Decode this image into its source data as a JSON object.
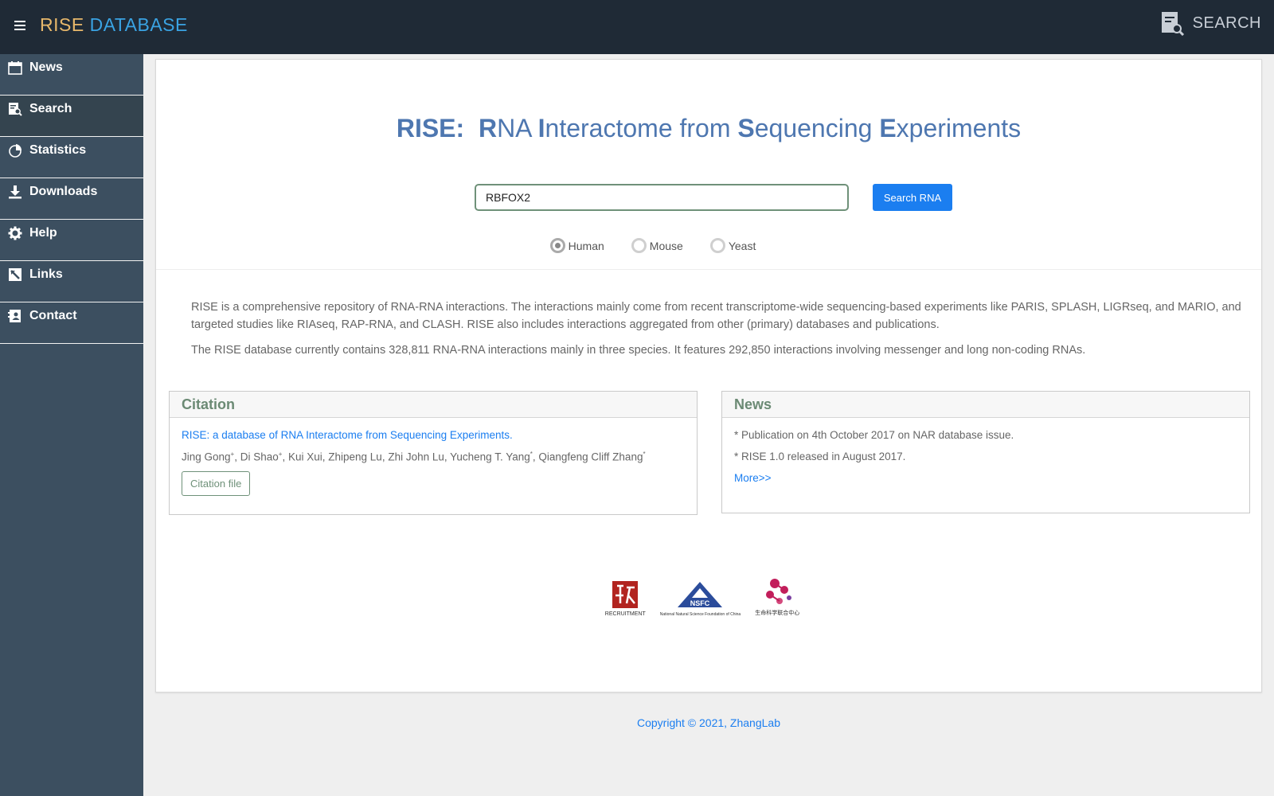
{
  "header": {
    "brand_part1": "RISE",
    "brand_part2": "DATABASE",
    "search_label": "SEARCH"
  },
  "sidebar": {
    "items": [
      {
        "label": "News",
        "icon": "calendar-icon"
      },
      {
        "label": "Search",
        "icon": "search-doc-icon"
      },
      {
        "label": "Statistics",
        "icon": "pie-chart-icon"
      },
      {
        "label": "Downloads",
        "icon": "download-icon"
      },
      {
        "label": "Help",
        "icon": "gear-icon"
      },
      {
        "label": "Links",
        "icon": "link-icon"
      },
      {
        "label": "Contact",
        "icon": "contact-icon"
      }
    ],
    "active_index": 1
  },
  "hero": {
    "title_prefix": "RISE:",
    "title_words": [
      {
        "initial": "R",
        "rest": "NA"
      },
      {
        "initial": "I",
        "rest": "nteractome from"
      },
      {
        "initial": "S",
        "rest": "equencing"
      },
      {
        "initial": "E",
        "rest": "xperiments"
      }
    ],
    "search_value": "RBFOX2",
    "search_button": "Search RNA",
    "species": [
      {
        "label": "Human",
        "selected": true
      },
      {
        "label": "Mouse",
        "selected": false
      },
      {
        "label": "Yeast",
        "selected": false
      }
    ]
  },
  "description": {
    "p1": "RISE is a comprehensive repository of RNA-RNA interactions. The interactions mainly come from recent transcriptome-wide sequencing-based experiments like PARIS, SPLASH, LIGRseq, and MARIO, and targeted studies like RIAseq, RAP-RNA, and CLASH. RISE also includes interactions aggregated from other (primary) databases and publications.",
    "p2": "The RISE database currently contains 328,811 RNA-RNA interactions mainly in three species. It features 292,850 interactions involving messenger and long non-coding RNAs."
  },
  "citation": {
    "heading": "Citation",
    "paper_title": "RISE: a database of RNA Interactome from Sequencing Experiments.",
    "authors": [
      {
        "name": "Jing Gong",
        "mark": "+"
      },
      {
        "name": "Di Shao",
        "mark": "+"
      },
      {
        "name": "Kui Xui",
        "mark": ""
      },
      {
        "name": "Zhipeng Lu",
        "mark": ""
      },
      {
        "name": "Zhi John Lu",
        "mark": ""
      },
      {
        "name": "Yucheng T. Yang",
        "mark": "*"
      },
      {
        "name": "Qiangfeng Cliff Zhang",
        "mark": "*"
      }
    ],
    "button": "Citation file"
  },
  "news": {
    "heading": "News",
    "items": [
      "* Publication on 4th October 2017 on NAR database issue.",
      "* RISE 1.0 released in August 2017."
    ],
    "more": "More>>"
  },
  "logos": {
    "recruitment_caption": "RECRUITMENT",
    "nsfc_text": "NSFC",
    "nsfc_caption": "National Natural Science Foundation of China",
    "cls_caption": "生命科学联合中心"
  },
  "footer": {
    "copyright": "Copyright © 2021, ZhangLab"
  },
  "colors": {
    "topbar": "#1f2a36",
    "sidebar": "#3c4f60",
    "title": "#4e77b0",
    "accent": "#1b7ef0",
    "panel_heading": "#6b8a74"
  }
}
